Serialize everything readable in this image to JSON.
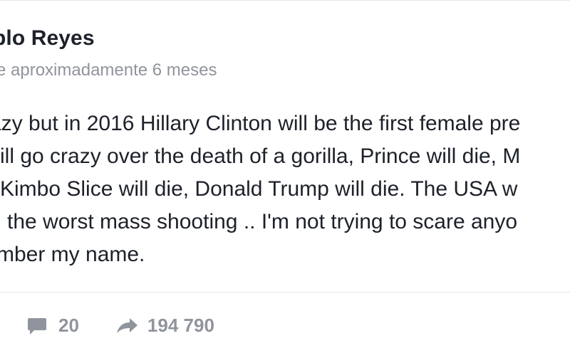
{
  "post": {
    "author_name": "blo Reyes",
    "timestamp": "e aproximadamente 6 meses",
    "lines": [
      "azy but in 2016 Hillary Clinton will be the first female pre",
      "vill go crazy over the death of a gorilla, Prince will die, M",
      "Kimbo Slice will die, Donald Trump will die. The USA w",
      "the worst mass shooting .. I'm not trying to scare anyo",
      "mber my name."
    ]
  },
  "actions": {
    "comment": {
      "icon": "comment-bubble-icon",
      "count": "20"
    },
    "share": {
      "icon": "share-arrow-icon",
      "count": "194 790"
    }
  },
  "colors": {
    "text_primary": "#1d2129",
    "text_secondary": "#90949c",
    "divider": "#e5e6e9"
  }
}
